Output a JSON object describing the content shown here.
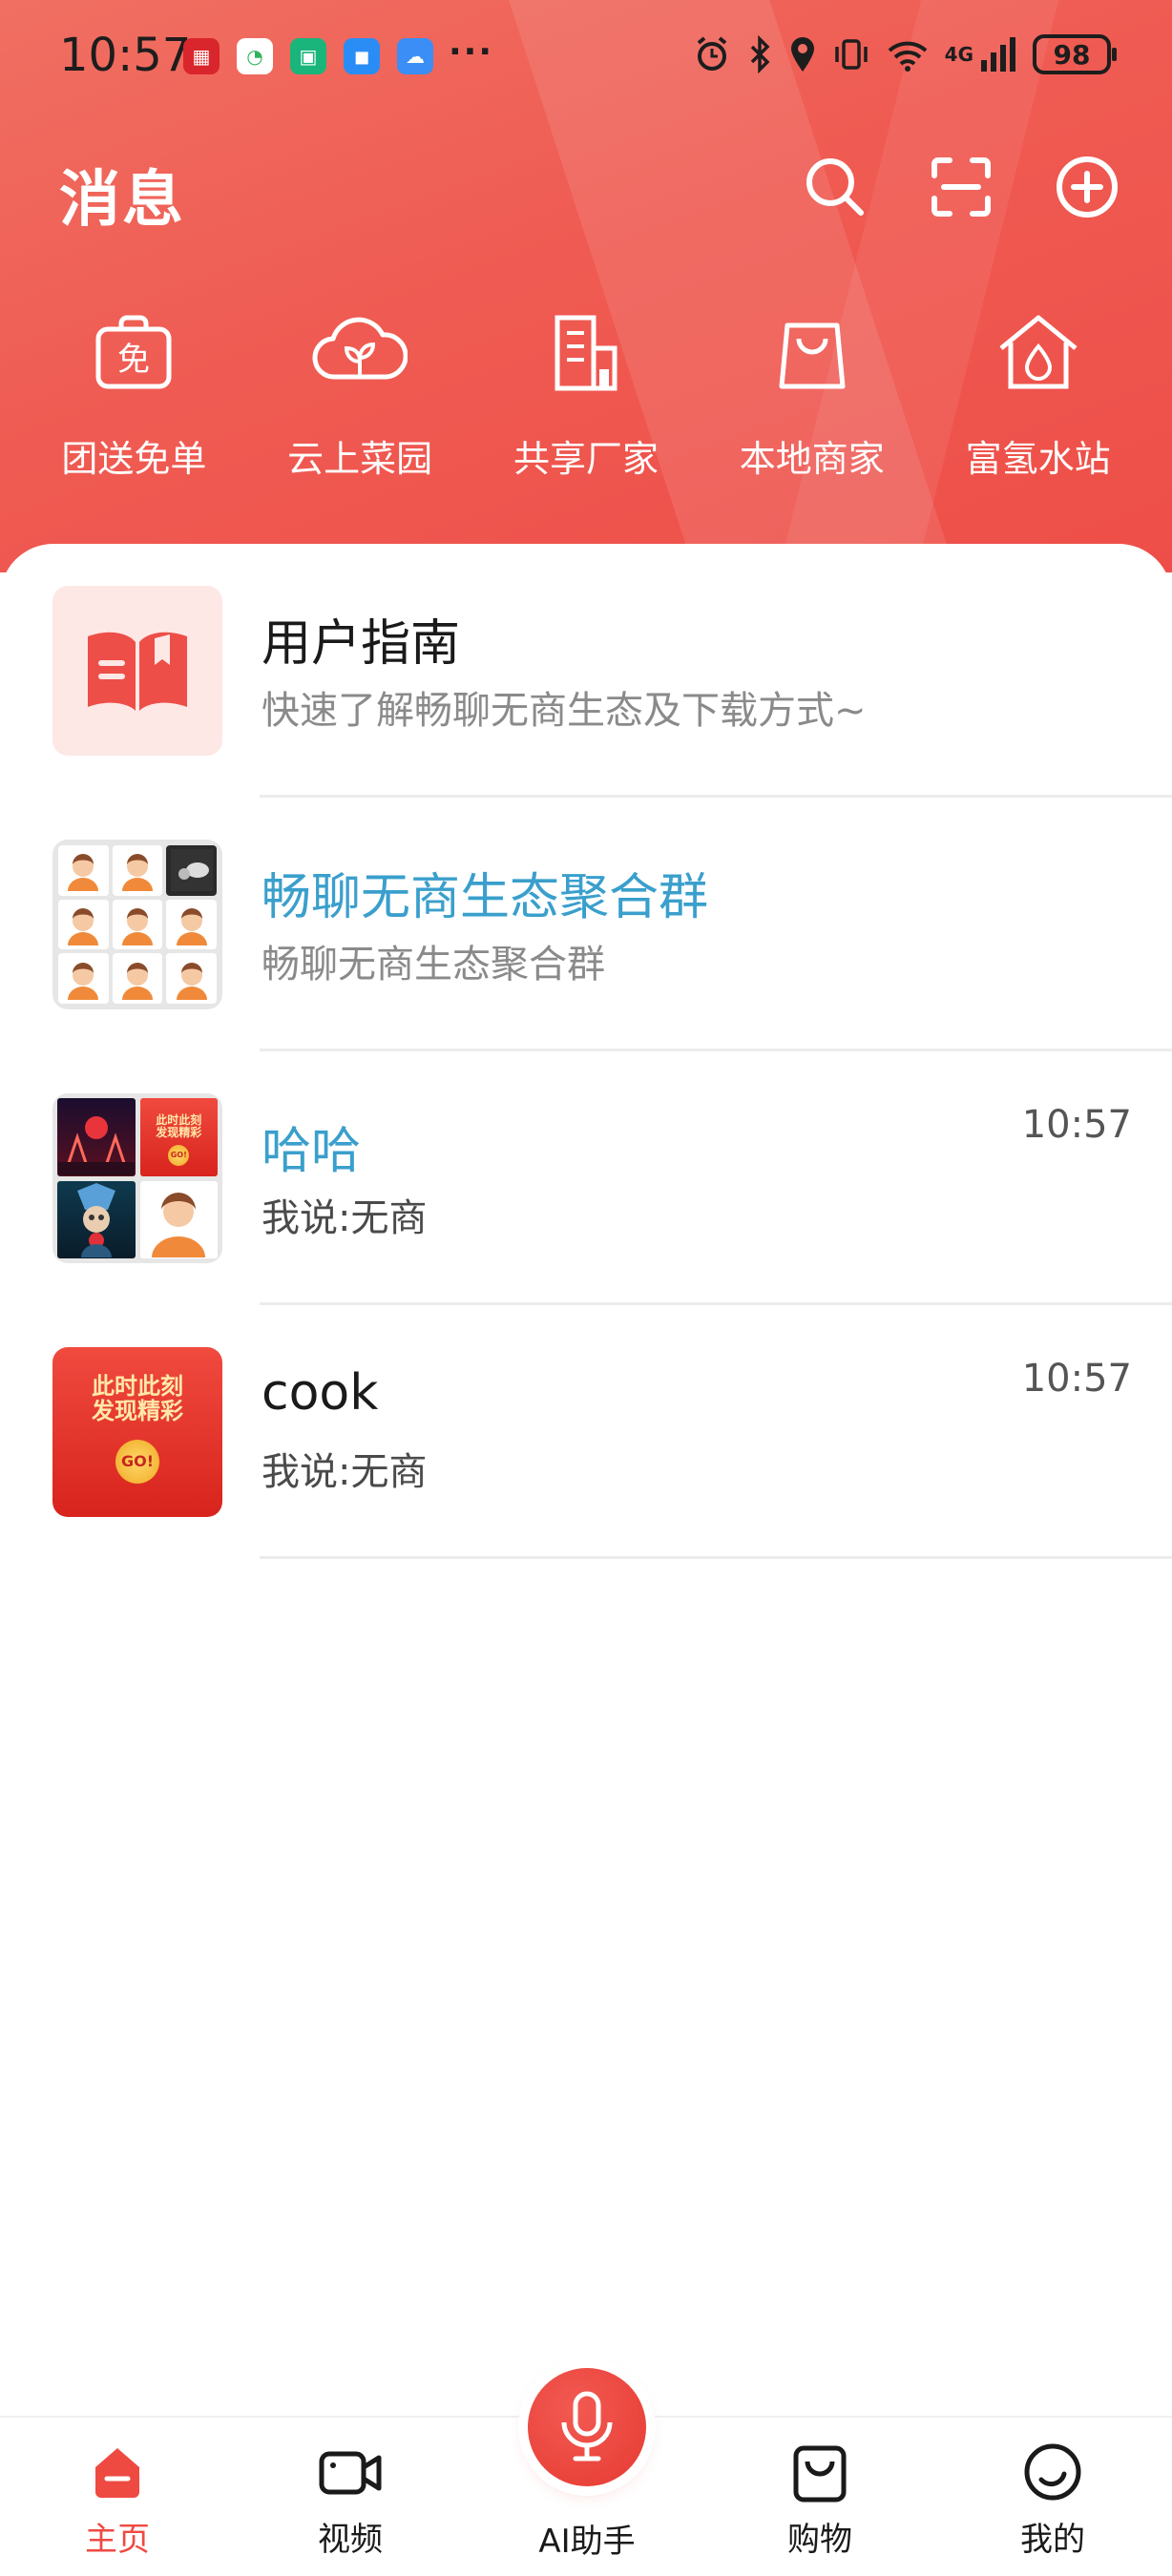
{
  "status_bar": {
    "time": "10:57",
    "battery": "98",
    "network_label": "4G"
  },
  "header": {
    "title": "消息",
    "actions": [
      {
        "icon": "search-icon"
      },
      {
        "icon": "scan-icon"
      },
      {
        "icon": "add-circle-icon"
      }
    ]
  },
  "quick_menu": [
    {
      "label": "团送免单",
      "icon": "free-bag-icon",
      "glyph": "免"
    },
    {
      "label": "云上菜园",
      "icon": "cloud-leaf-icon"
    },
    {
      "label": "共享厂家",
      "icon": "building-icon"
    },
    {
      "label": "本地商家",
      "icon": "shopping-bag-icon"
    },
    {
      "label": "富氢水站",
      "icon": "water-house-icon"
    }
  ],
  "chats": [
    {
      "name": "用户指南",
      "preview": "快速了解畅聊无商生态及下载方式~",
      "time": "",
      "avatar": "book-icon"
    },
    {
      "name": "畅聊无商生态聚合群",
      "preview": "畅聊无商生态聚合群",
      "time": "",
      "avatar": "group-avatar-grid"
    },
    {
      "name": "哈哈",
      "preview": "我说:无商",
      "time": "10:57",
      "avatar": "group-avatar-grid"
    },
    {
      "name": "cook",
      "preview": "我说:无商",
      "time": "10:57",
      "avatar": "promo-avatar"
    }
  ],
  "promo_avatar": {
    "line1": "此时此刻",
    "line2": "发现精彩",
    "button": "GO!"
  },
  "bottom_nav": [
    {
      "label": "主页",
      "icon": "home-icon",
      "active": true
    },
    {
      "label": "视频",
      "icon": "video-icon",
      "active": false
    },
    {
      "label": "AI助手",
      "icon": "microphone-icon",
      "active": false
    },
    {
      "label": "购物",
      "icon": "shopping-bag-icon",
      "active": false
    },
    {
      "label": "我的",
      "icon": "profile-icon",
      "active": false
    }
  ],
  "colors": {
    "brand_red": "#ee4e48",
    "group_name_blue": "#3a9fcc",
    "active_nav": "#ee4a42"
  }
}
